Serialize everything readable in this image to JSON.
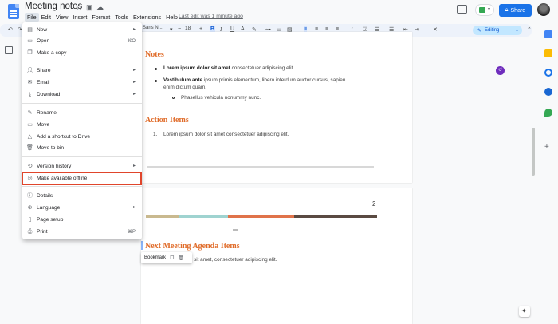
{
  "header": {
    "title": "Meeting notes",
    "last_edit": "Last edit was 1 minute ago",
    "share_label": "Share",
    "menus": [
      "File",
      "Edit",
      "View",
      "Insert",
      "Format",
      "Tools",
      "Extensions",
      "Help"
    ]
  },
  "toolbar": {
    "font": "Sans N...",
    "font_size": "18",
    "mode": "Editing"
  },
  "file_menu": {
    "items": [
      {
        "icon": "new-doc-icon",
        "label": "New",
        "shortcut": "",
        "submenu": true
      },
      {
        "icon": "open-folder-icon",
        "label": "Open",
        "shortcut": "⌘O",
        "submenu": false
      },
      {
        "icon": "copy-icon",
        "label": "Make a copy",
        "shortcut": "",
        "submenu": false
      },
      {
        "icon": "share-person-icon",
        "label": "Share",
        "shortcut": "",
        "submenu": true
      },
      {
        "icon": "email-icon",
        "label": "Email",
        "shortcut": "",
        "submenu": true
      },
      {
        "icon": "download-icon",
        "label": "Download",
        "shortcut": "",
        "submenu": true
      },
      {
        "icon": "rename-icon",
        "label": "Rename",
        "shortcut": "",
        "submenu": false
      },
      {
        "icon": "move-icon",
        "label": "Move",
        "shortcut": "",
        "submenu": false
      },
      {
        "icon": "drive-shortcut-icon",
        "label": "Add a shortcut to Drive",
        "shortcut": "",
        "submenu": false
      },
      {
        "icon": "trash-icon",
        "label": "Move to bin",
        "shortcut": "",
        "submenu": false
      },
      {
        "icon": "history-icon",
        "label": "Version history",
        "shortcut": "",
        "submenu": true
      },
      {
        "icon": "offline-icon",
        "label": "Make available offline",
        "shortcut": "",
        "submenu": false
      },
      {
        "icon": "info-icon",
        "label": "Details",
        "shortcut": "",
        "submenu": false
      },
      {
        "icon": "globe-icon",
        "label": "Language",
        "shortcut": "",
        "submenu": true
      },
      {
        "icon": "page-setup-icon",
        "label": "Page setup",
        "shortcut": "",
        "submenu": false
      },
      {
        "icon": "print-icon",
        "label": "Print",
        "shortcut": "⌘P",
        "submenu": false
      }
    ]
  },
  "doc": {
    "notes_heading": "Notes",
    "bullet1_bold": "Lorem ipsum dolor sit amet",
    "bullet1_rest": " consectetuer adipiscing elit.",
    "bullet2_bold": "Vestibulum ante",
    "bullet2_rest": " ipsum primis elementum, libero interdum auctor cursus, sapien",
    "bullet2_cont": "enim dictum quam.",
    "sub_bullet": "Phasellus vehicula nonummy nunc.",
    "action_heading": "Action Items",
    "action_item": "Lorem ipsum dolor sit amet consectetuer adipiscing elit.",
    "action_num": "1.",
    "page_number": "2",
    "next_heading": "Next Meeting Agenda Items",
    "next_text": "sit amet, consectetuer adipiscing elit.",
    "bookmark_label": "Bookmark"
  },
  "colors": {
    "accent": "#1a73e8",
    "heading": "#e06c2a",
    "highlight": "#e0452b",
    "stripe": [
      "#c9b98f",
      "#9fd3d0",
      "#e0734a",
      "#5a4a42"
    ]
  }
}
